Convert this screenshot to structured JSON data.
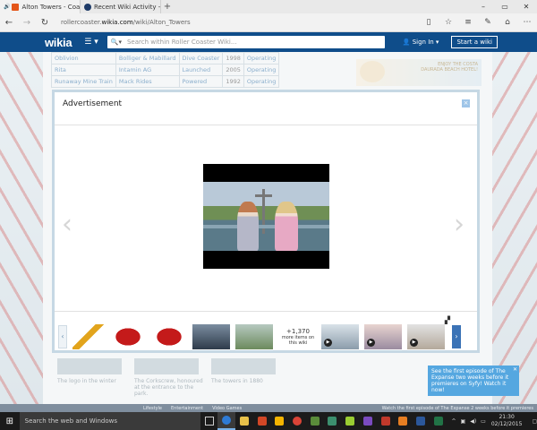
{
  "browser": {
    "tabs": [
      {
        "label": "Alton Towers - Coas",
        "active": true
      },
      {
        "label": "Recent Wiki Activity - Wikia",
        "active": false
      }
    ],
    "url_prefix": "rollercoaster.",
    "url_domain": "wikia.com",
    "url_path": "/wiki/Alton_Towers"
  },
  "wikia": {
    "logo": "wikia",
    "search_placeholder": "Search within Roller Coaster Wiki...",
    "signin": "Sign In",
    "start_wiki": "Start a wiki"
  },
  "background_table": {
    "rows": [
      [
        "Oblivion",
        "Bolliger & Mabillard",
        "Dive Coaster",
        "1998",
        "Operating"
      ],
      [
        "Rita",
        "Intamin AG",
        "Launched",
        "2005",
        "Operating"
      ],
      [
        "Runaway Mine Train",
        "Mack Rides",
        "Powered",
        "1992",
        "Operating"
      ]
    ]
  },
  "background_ad": {
    "text": "ENJOY THE COSTA DAURADA BEACH HOTEL!"
  },
  "background_captions": [
    "The logo in the winter",
    "The Corkscrew, honoured at the entrance to the park.",
    "The towers in 1880"
  ],
  "toast": {
    "text": "See the first episode of The Expanse two weeks before it premieres on Syfy! Watch it now!"
  },
  "bottom_toolbar": {
    "links": [
      "Lifestyle",
      "Entertainment",
      "Video Games"
    ],
    "right": "Watch the first episode of The Expanse 2 weeks before it premieres"
  },
  "modal": {
    "title": "Advertisement",
    "close": "×",
    "prev": "‹",
    "next": "›",
    "more_count": "+1,370",
    "more_label": "more items on this wiki"
  },
  "taskbar": {
    "search": "Search the web and Windows",
    "time": "21:30",
    "date": "02/12/2015"
  },
  "colors": {
    "wikia_header": "#0f4d8a",
    "accent": "#3b73b6",
    "taskbar": "#1b1b1b"
  }
}
